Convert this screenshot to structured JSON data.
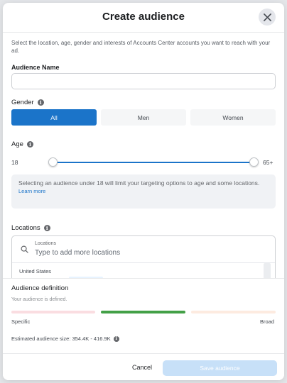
{
  "modal": {
    "title": "Create audience",
    "description": "Select the location, age, gender and interests of Accounts Center accounts you want to reach with your ad."
  },
  "audience_name": {
    "label": "Audience Name",
    "value": "",
    "placeholder": ""
  },
  "gender": {
    "label": "Gender",
    "options": [
      "All",
      "Men",
      "Women"
    ],
    "selected": "All"
  },
  "age": {
    "label": "Age",
    "min": "18",
    "max": "65+",
    "note": "Selecting an audience under 18 will limit your targeting options to age and some locations.",
    "learn_more": "Learn more"
  },
  "locations": {
    "label": "Locations",
    "field_label": "Locations",
    "placeholder": "Type to add more locations",
    "items": [
      "United States"
    ]
  },
  "definition": {
    "title": "Audience definition",
    "subtitle": "Your audience is defined.",
    "specific_label": "Specific",
    "broad_label": "Broad",
    "estimated_size": "Estimated audience size: 354.4K - 416.9K"
  },
  "footer": {
    "cancel_label": "Cancel",
    "save_label": "Save audience"
  },
  "colors": {
    "accent": "#1b74c9",
    "meter_good": "#43a047",
    "save_disabled": "#c7e0f8"
  },
  "icons": {
    "close": "close-icon",
    "info": "info-icon",
    "search": "search-icon"
  }
}
